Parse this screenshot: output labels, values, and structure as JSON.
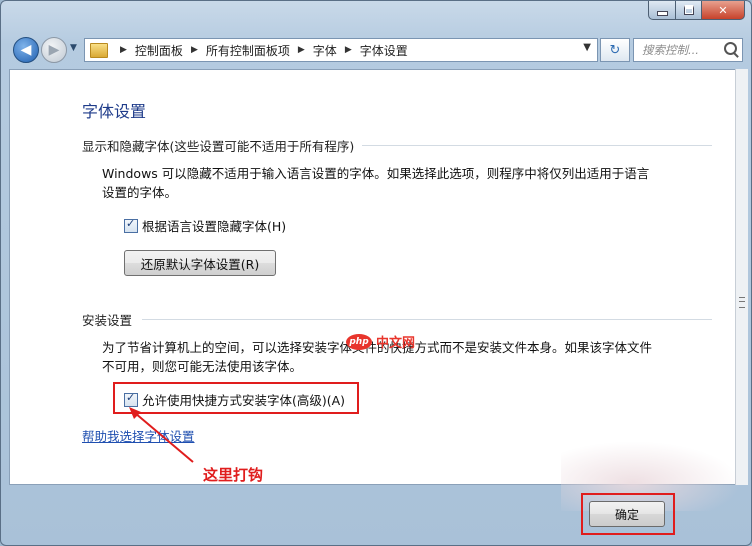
{
  "address_bar": {
    "crumbs": [
      "控制面板",
      "所有控制面板项",
      "字体",
      "字体设置"
    ]
  },
  "search": {
    "placeholder": "搜索控制..."
  },
  "page": {
    "title": "字体设置",
    "section1": {
      "heading": "显示和隐藏字体(这些设置可能不适用于所有程序)",
      "desc_line1": "Windows 可以隐藏不适用于输入语言设置的字体。如果选择此选项，则程序中将仅列出适用于语言",
      "desc_line2": "设置的字体。",
      "checkbox_label": "根据语言设置隐藏字体(H)",
      "restore_button": "还原默认字体设置(R)"
    },
    "section2": {
      "heading": "安装设置",
      "desc_line1": "为了节省计算机上的空间，可以选择安装字体文件的快捷方式而不是安装文件本身。如果该字体文件",
      "desc_line2": "不可用，则您可能无法使用该字体。",
      "checkbox_label": "允许使用快捷方式安装字体(高级)(A)"
    },
    "help_link": "帮助我选择字体设置"
  },
  "annotation": {
    "text": "这里打钩",
    "color": "#e01d1d"
  },
  "footer": {
    "ok_button": "确定"
  },
  "watermark": {
    "logo": "php",
    "text": "中文网"
  },
  "colors": {
    "title_blue": "#1e3b8a",
    "link_blue": "#1f4fb0",
    "annotation_red": "#e01d1d"
  },
  "icons": [
    "back-arrow-icon",
    "forward-arrow-icon",
    "folder-icon",
    "refresh-icon",
    "search-icon",
    "checkmark-icon"
  ]
}
